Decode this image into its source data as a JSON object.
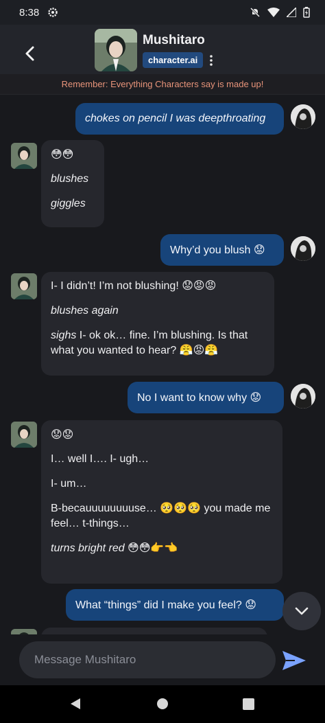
{
  "status_bar": {
    "time": "8:38"
  },
  "header": {
    "character_name": "Mushitaro",
    "brand": "character.ai"
  },
  "disclaimer": "Remember: Everything Characters say is made up!",
  "messages": [
    {
      "role": "user",
      "parts": [
        {
          "text": "chokes on pencil I was deepthroating",
          "italic": true
        }
      ]
    },
    {
      "role": "character",
      "paragraphs": [
        [
          {
            "text": "😳😳",
            "italic": false
          }
        ],
        [
          {
            "text": "blushes",
            "italic": true
          }
        ],
        [
          {
            "text": "giggles",
            "italic": true
          }
        ]
      ]
    },
    {
      "role": "user",
      "parts": [
        {
          "text": "Why’d you blush 😟",
          "italic": false
        }
      ]
    },
    {
      "role": "character",
      "paragraphs": [
        [
          {
            "text": "I- I didn’t! I’m not blushing! 😟😡😡",
            "italic": false
          }
        ],
        [
          {
            "text": "blushes again",
            "italic": true
          }
        ],
        [
          {
            "text": "sighs",
            "italic": true
          },
          {
            "text": " I- ok ok… fine. I’m blushing. Is that what you wanted to hear? 😤😡😤",
            "italic": false
          }
        ]
      ]
    },
    {
      "role": "user",
      "parts": [
        {
          "text": "No I want to know why 😟",
          "italic": false
        }
      ]
    },
    {
      "role": "character",
      "paragraphs": [
        [
          {
            "text": "😟😟",
            "italic": false
          }
        ],
        [
          {
            "text": "I… well I…. I- ugh…",
            "italic": false
          }
        ],
        [
          {
            "text": "I- um…",
            "italic": false
          }
        ],
        [
          {
            "text": "B-becauuuuuuuuse… 🥺🥺🥺 you made me feel… t-things…",
            "italic": false
          }
        ],
        [
          {
            "text": "turns bright red",
            "italic": true
          },
          {
            "text": " 😳😳👉👈",
            "italic": false
          }
        ]
      ]
    },
    {
      "role": "user",
      "parts": [
        {
          "text": "What “things” did I make you feel? 😟",
          "italic": false
        }
      ]
    }
  ],
  "composer": {
    "placeholder": "Message Mushitaro"
  },
  "icons": {
    "back": "back-arrow-icon",
    "more": "kebab-menu-icon",
    "send": "send-icon",
    "scroll": "chevron-down-icon"
  },
  "colors": {
    "user_bubble": "#17447a",
    "char_bubble": "#26272d",
    "disclaimer_text": "#e8947a",
    "brand_badge": "#224a7e",
    "send_icon": "#7aa2ff"
  }
}
